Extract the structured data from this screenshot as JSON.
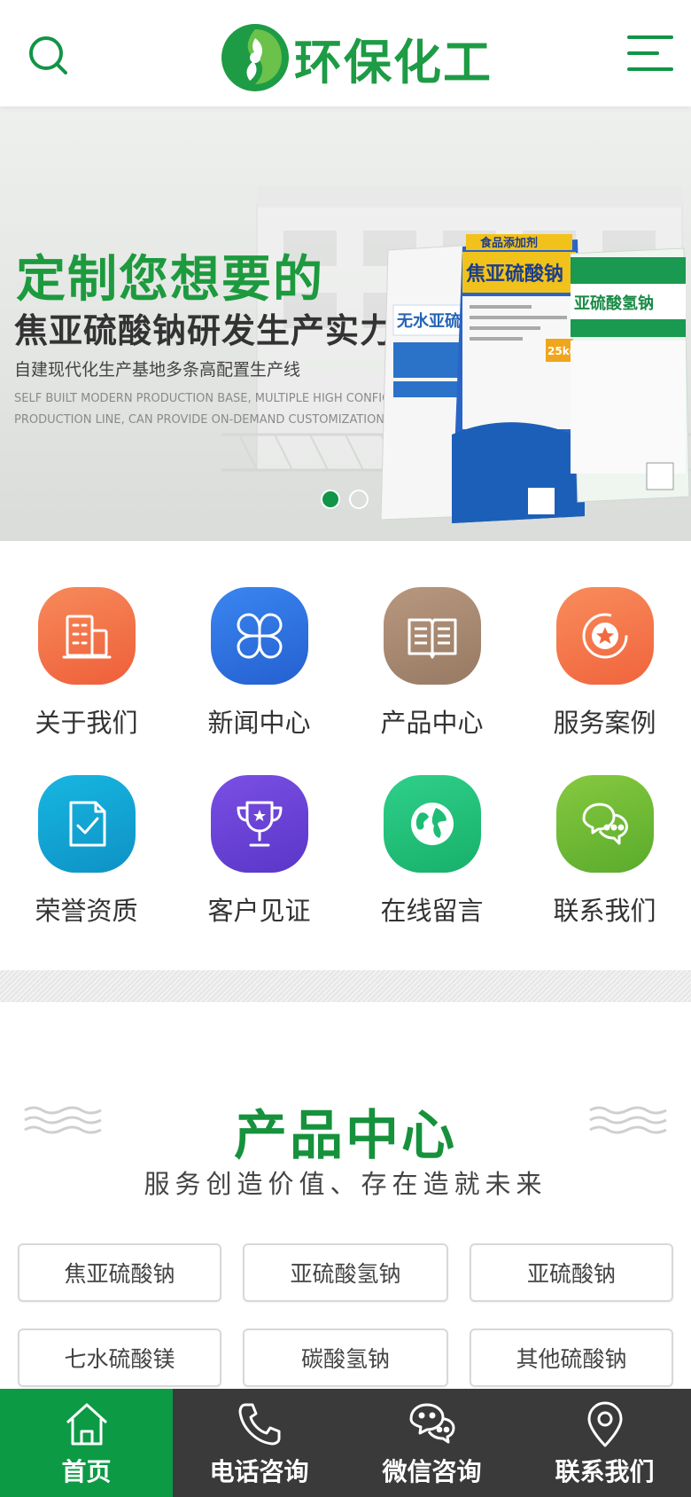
{
  "header": {
    "logo_text": "环保化工"
  },
  "banner": {
    "headline": "定制您想要的",
    "subheadline": "焦亚硫酸钠研发生产实力",
    "description": "自建现代化生产基地多条高配置生产线",
    "english_line1": "SELF BUILT MODERN PRODUCTION BASE, MULTIPLE HIGH CONFIGU",
    "english_line2": "PRODUCTION LINE, CAN PROVIDE ON-DEMAND CUSTOMIZATION.",
    "bag_labels": [
      "无水亚硫酸",
      "焦亚硫酸钠",
      "亚硫酸氢钠"
    ],
    "bag_tag": "食品添加剂",
    "bag_weight": "25kg",
    "slide_count": 2,
    "active_slide": 1
  },
  "grid": {
    "items": [
      {
        "label": "关于我们",
        "icon": "building-icon",
        "color": "#f3754a"
      },
      {
        "label": "新闻中心",
        "icon": "clover-icon",
        "color": "#2f74e0"
      },
      {
        "label": "产品中心",
        "icon": "book-icon",
        "color": "#a98a72"
      },
      {
        "label": "服务案例",
        "icon": "star-icon",
        "color": "#f47a4c"
      },
      {
        "label": "荣誉资质",
        "icon": "document-check-icon",
        "color": "#13a7d6"
      },
      {
        "label": "客户见证",
        "icon": "trophy-icon",
        "color": "#6a45d8"
      },
      {
        "label": "在线留言",
        "icon": "globe-icon",
        "color": "#22c27a"
      },
      {
        "label": "联系我们",
        "icon": "chat-icon",
        "color": "#6fbc35"
      }
    ]
  },
  "products": {
    "title": "产品中心",
    "subtitle": "服务创造价值、存在造就未来",
    "categories": [
      "焦亚硫酸钠",
      "亚硫酸氢钠",
      "亚硫酸钠",
      "七水硫酸镁",
      "碳酸氢钠",
      "其他硫酸钠"
    ]
  },
  "bottom_nav": {
    "items": [
      {
        "label": "首页",
        "icon": "home-icon"
      },
      {
        "label": "电话咨询",
        "icon": "phone-icon"
      },
      {
        "label": "微信咨询",
        "icon": "wechat-icon"
      },
      {
        "label": "联系我们",
        "icon": "location-pin-icon"
      }
    ]
  },
  "colors": {
    "brand_green": "#16913c",
    "nav_bg": "#3a3a3a",
    "nav_active": "#0c9a45"
  }
}
